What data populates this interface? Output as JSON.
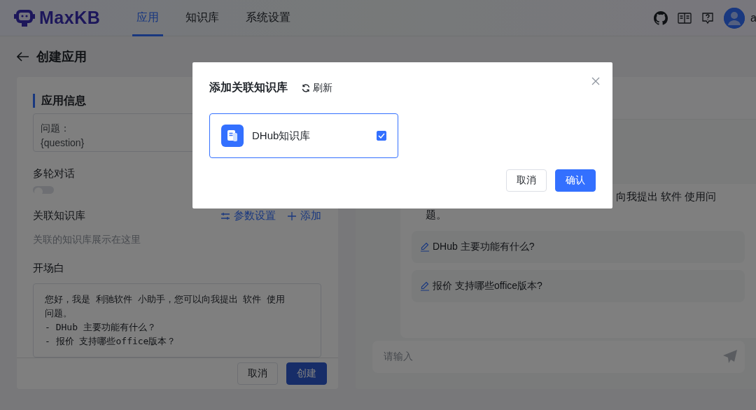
{
  "header": {
    "logo": "MaxKB",
    "tabs": [
      {
        "label": "应用",
        "selected": true
      },
      {
        "label": "知识库",
        "selected": false
      },
      {
        "label": "系统设置",
        "selected": false
      }
    ],
    "user_name": "a"
  },
  "page": {
    "title": "创建应用"
  },
  "form": {
    "section_title": "应用信息",
    "prompt_lines": [
      "问题：",
      "{question}"
    ],
    "multi_turn": {
      "label": "多轮对话",
      "on": false
    },
    "knowledge": {
      "label": "关联知识库",
      "actions": [
        {
          "kind": "settings",
          "label": "参数设置"
        },
        {
          "kind": "add",
          "label": "添加"
        }
      ],
      "placeholder": "关联的知识库展示在这里"
    },
    "opening": {
      "label": "开场白",
      "lines": [
        "您好，我是 利驰软件 小助手，您可以向我提出 软件 使用",
        "问题。",
        "- DHub 主要功能有什么？",
        "- 报价 支持哪些office版本？"
      ]
    },
    "buttons": [
      {
        "label": "取消",
        "kind": "default"
      },
      {
        "label": "创建",
        "kind": "primary"
      }
    ]
  },
  "preview": {
    "message_lines": [
      "向我提出 软件 使用问",
      "题。"
    ],
    "suggestions": [
      "DHub 主要功能有什么?",
      "报价 支持哪些office版本?"
    ],
    "input_placeholder": "请输入"
  },
  "dialog": {
    "title": "添加关联知识库",
    "refresh": "刷新",
    "items": [
      {
        "name": "DHub知识库",
        "selected": true
      }
    ],
    "buttons": [
      {
        "label": "取消",
        "kind": "default"
      },
      {
        "label": "确认",
        "kind": "primary"
      }
    ]
  }
}
